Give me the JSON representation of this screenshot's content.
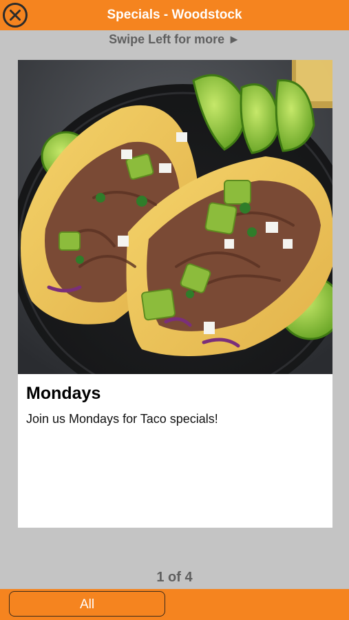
{
  "header": {
    "title": "Specials - Woodstock",
    "close_icon": "close-circle-icon"
  },
  "swipe_hint": "Swipe Left for more ►",
  "special": {
    "image": "tacos-photo",
    "title": "Mondays",
    "description": "Join us Mondays for Taco specials!"
  },
  "pager": "1 of 4",
  "footer": {
    "all_label": "All"
  },
  "colors": {
    "accent": "#f5841f",
    "background": "#c4c4c4",
    "muted_text": "#5f5f5f"
  }
}
